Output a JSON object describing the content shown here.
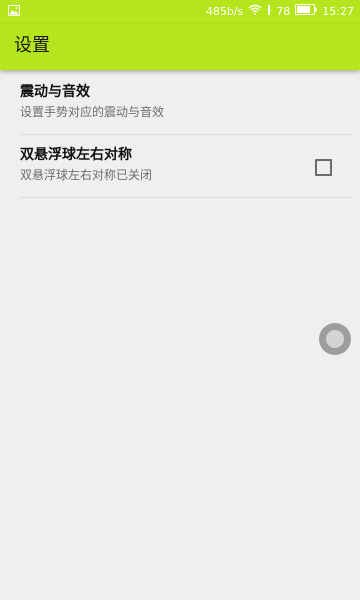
{
  "status_bar": {
    "net_speed": "485b/s",
    "battery_level": "78",
    "time": "15:27",
    "icons": [
      "image-notification-icon",
      "wifi-icon",
      "signal-icon",
      "battery-icon"
    ]
  },
  "toolbar": {
    "title": "设置"
  },
  "settings": {
    "items": [
      {
        "title": "震动与音效",
        "subtitle": "设置手势对应的震动与音效"
      },
      {
        "title": "双悬浮球左右对称",
        "subtitle": "双悬浮球左右对称已关闭",
        "checked": false
      }
    ]
  },
  "colors": {
    "accent": "#b5e61d",
    "background": "#efefef",
    "divider": "#dcdcdc",
    "float_ball": "#9d9d9d"
  }
}
